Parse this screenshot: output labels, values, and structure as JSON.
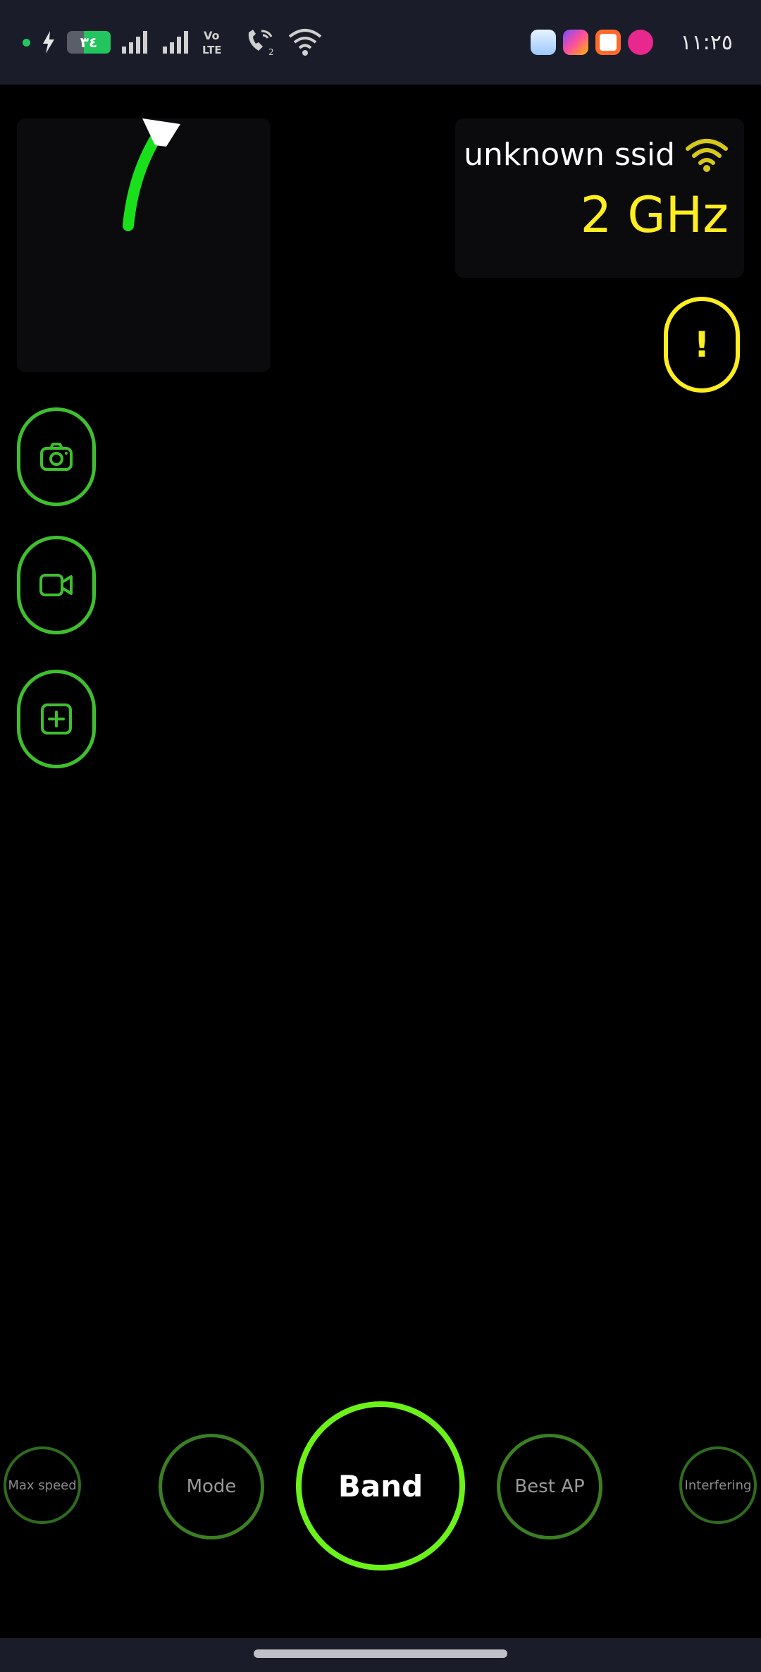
{
  "status_bar": {
    "battery": "٣٤",
    "battery_level": 0.34,
    "volte": "Vo\nLTE",
    "clock": "١١:٢٥",
    "icons": [
      "notification-dot-icon",
      "charging-icon",
      "battery-icon",
      "signal-icon",
      "signal-icon",
      "volte-icon",
      "wifi-call-icon",
      "wifi-icon"
    ],
    "app_icons": [
      "app-icon-1",
      "app-icon-2",
      "app-icon-3",
      "app-icon-4"
    ]
  },
  "info_card": {
    "ssid": "unknown ssid",
    "band": "2 GHz",
    "accent": "#ffee1f"
  },
  "side_buttons": [
    "camera-icon",
    "video-icon",
    "add-icon"
  ],
  "alert_button": {
    "label": "!"
  },
  "mode_selector": {
    "items": [
      "Max speed",
      "Mode",
      "Band",
      "Best AP",
      "Interfering"
    ],
    "active": "Band",
    "accent": "#6cf21a"
  }
}
